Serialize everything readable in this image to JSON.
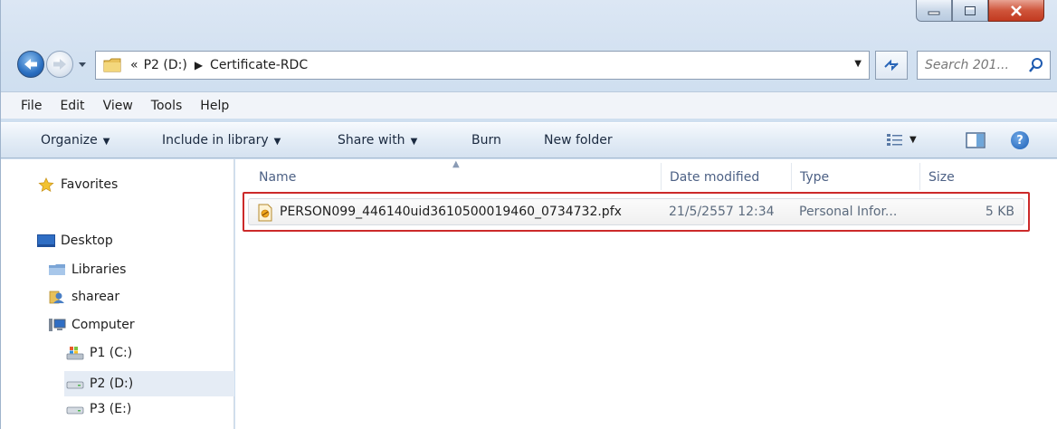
{
  "window": {
    "controls": [
      "minimize-icon",
      "maximize-icon",
      "close-icon"
    ]
  },
  "address": {
    "overflow": "«",
    "crumbs": [
      "P2 (D:)",
      "Certificate-RDC"
    ]
  },
  "search": {
    "placeholder": "Search 201..."
  },
  "menu": [
    "File",
    "Edit",
    "View",
    "Tools",
    "Help"
  ],
  "commands": {
    "organize": "Organize",
    "include": "Include in library",
    "share": "Share with",
    "burn": "Burn",
    "new_folder": "New folder"
  },
  "nav": {
    "favorites": "Favorites",
    "desktop": "Desktop",
    "libraries": "Libraries",
    "user": "sharear",
    "computer": "Computer",
    "drives": [
      "P1 (C:)",
      "P2 (D:)",
      "P3 (E:)"
    ]
  },
  "columns": {
    "name": "Name",
    "date": "Date modified",
    "type": "Type",
    "size": "Size"
  },
  "files": [
    {
      "name": "PERSON099_446140uid3610500019460_0734732.pfx",
      "date": "21/5/2557 12:34",
      "type": "Personal Infor...",
      "size": "5 KB"
    }
  ],
  "colors": {
    "highlight_border": "#cc2a2a",
    "chrome": "#d3e1f1"
  }
}
